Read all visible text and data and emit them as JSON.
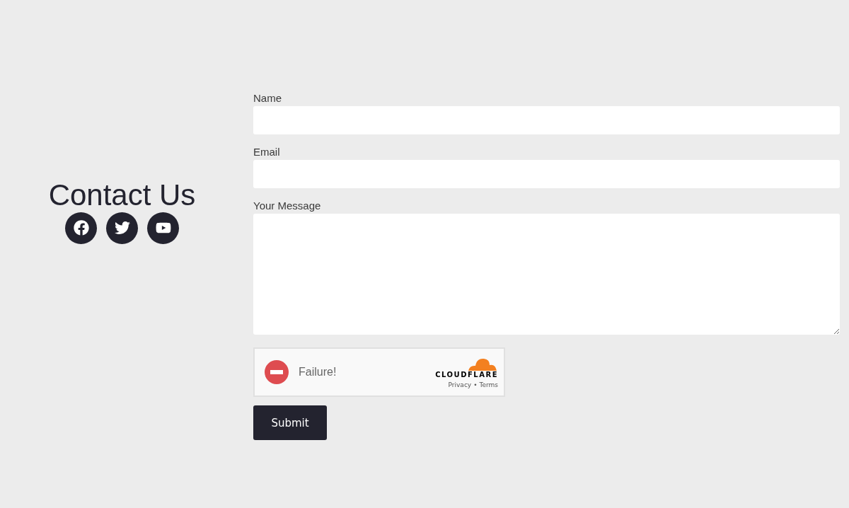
{
  "heading": "Contact Us",
  "social": [
    {
      "kind": "facebook"
    },
    {
      "kind": "twitter"
    },
    {
      "kind": "youtube"
    }
  ],
  "fields": [
    {
      "kind": "text",
      "label": "Name"
    },
    {
      "kind": "text",
      "label": "Email"
    },
    {
      "kind": "textarea",
      "label": "Your Message"
    }
  ],
  "captcha": {
    "status": "Failure!",
    "brand": "CLOUDFLARE",
    "links": [
      "Privacy",
      "Terms"
    ],
    "separator": "•"
  },
  "submit": "Submit"
}
